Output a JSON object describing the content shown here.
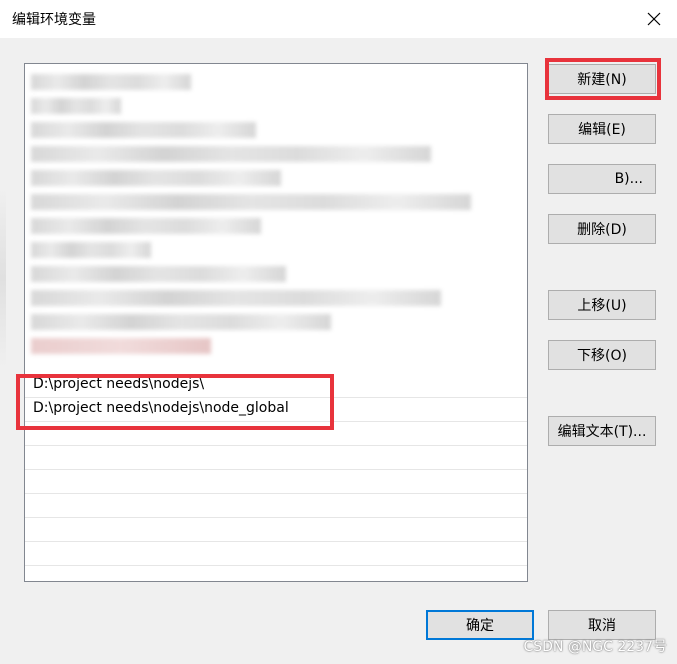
{
  "window": {
    "title": "编辑环境变量",
    "close_icon": "close-icon"
  },
  "list": {
    "visible_entries": [
      "D:\\project needs\\nodejs\\",
      "D:\\project needs\\nodejs\\node_global"
    ]
  },
  "buttons": {
    "new": "新建(N)",
    "edit": "编辑(E)",
    "browse": "B)...",
    "delete": "删除(D)",
    "move_up": "上移(U)",
    "move_down": "下移(O)",
    "edit_text": "编辑文本(T)...",
    "ok": "确定",
    "cancel": "取消"
  },
  "watermark": "CSDN @NGC 2237号",
  "colors": {
    "highlight": "#e8333c",
    "default_button_border": "#0078d7"
  }
}
